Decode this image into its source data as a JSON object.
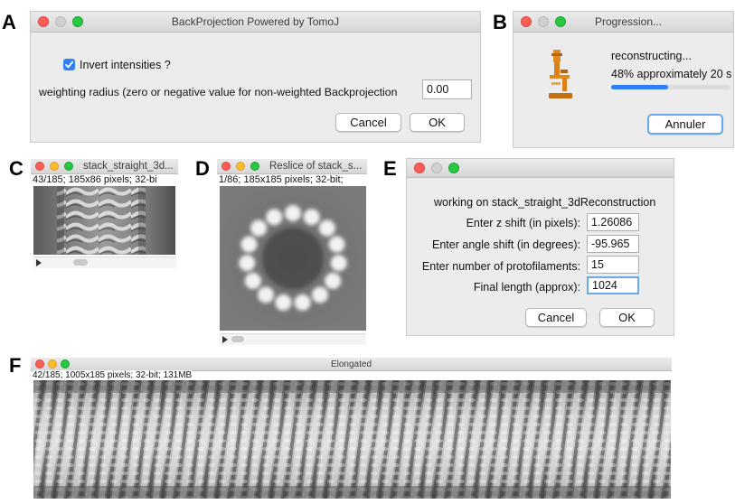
{
  "panels": {
    "a": {
      "letter": "A",
      "title": "BackProjection Powered by TomoJ",
      "checkbox_label": "Invert intensities ?",
      "checkbox_checked": true,
      "field_label": "weighting radius (zero or negative value for non-weighted Backprojection",
      "field_value": "0.00",
      "cancel_label": "Cancel",
      "ok_label": "OK"
    },
    "b": {
      "letter": "B",
      "title": "Progression...",
      "status": "reconstructing...",
      "detail": "48% approximately 20 s",
      "progress": 0.48,
      "button_label": "Annuler",
      "icon": "microscope-icon"
    },
    "c": {
      "letter": "C",
      "title": "stack_straight_3d...",
      "info": "43/185; 185x86 pixels; 32-bi"
    },
    "d": {
      "letter": "D",
      "title": "Reslice of stack_s...",
      "info": "1/86; 185x185 pixels; 32-bit;"
    },
    "e": {
      "letter": "E",
      "header": "working on stack_straight_3dReconstruction",
      "fields": [
        {
          "label": "Enter z shift (in pixels):",
          "value": "1.26086"
        },
        {
          "label": "Enter angle shift (in degrees):",
          "value": "-95.965"
        },
        {
          "label": "Enter number of protofilaments:",
          "value": "15"
        },
        {
          "label": "Final length (approx):",
          "value": "1024"
        }
      ],
      "cancel_label": "Cancel",
      "ok_label": "OK"
    },
    "f": {
      "letter": "F",
      "title": "Elongated",
      "info": "42/185; 1005x185 pixels; 32-bit; 131MB"
    }
  }
}
